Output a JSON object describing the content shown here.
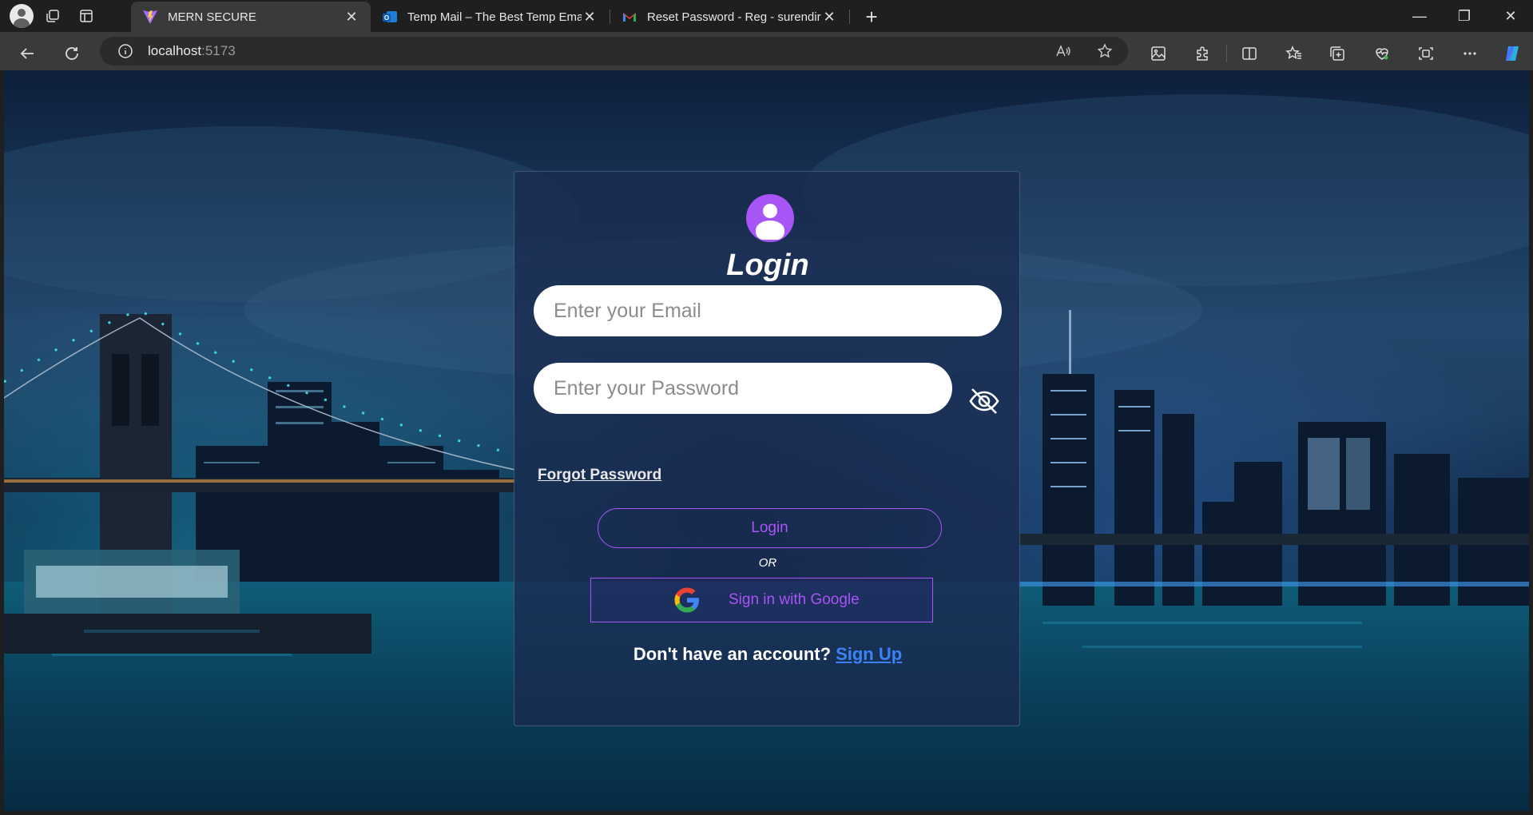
{
  "browser": {
    "tabs": [
      {
        "title": "MERN SECURE",
        "favicon": "vite-icon",
        "active": true
      },
      {
        "title": "Temp Mail – The Best Temp Emai",
        "favicon": "outlook-icon",
        "active": false
      },
      {
        "title": "Reset Password - Reg - surendira",
        "favicon": "gmail-icon",
        "active": false
      }
    ],
    "url_host": "localhost",
    "url_port": ":5173"
  },
  "login": {
    "title": "Login",
    "email_placeholder": "Enter your Email",
    "password_placeholder": "Enter your Password",
    "forgot_password": "Forgot Password",
    "login_button": "Login",
    "or_text": "OR",
    "google_button": "Sign in with Google",
    "no_account_text": "Don't have an account?",
    "signup_link": "Sign Up"
  },
  "colors": {
    "accent": "#a855f7",
    "link": "#3b82f6",
    "card_bg": "#192a50"
  }
}
